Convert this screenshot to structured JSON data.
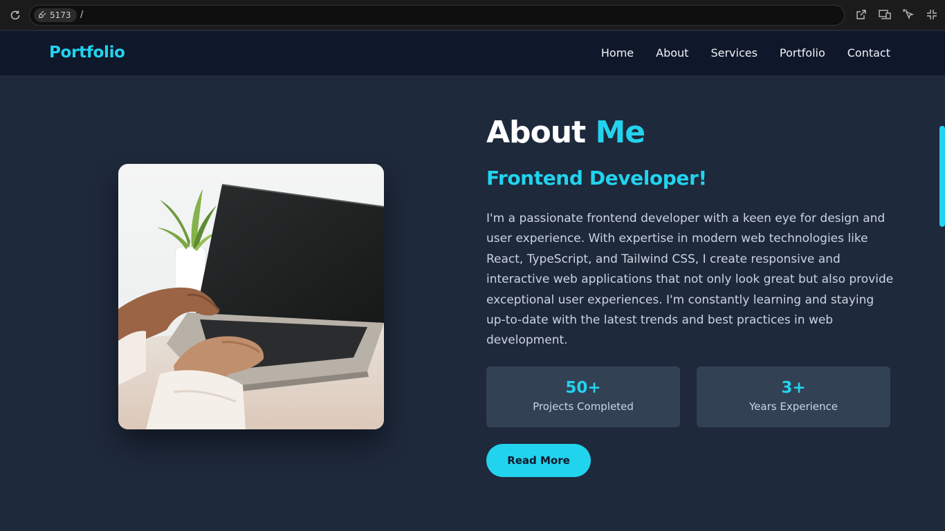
{
  "browser": {
    "port": "5173",
    "path": "/",
    "icons": [
      "reload-icon",
      "plug-icon",
      "open-external-icon",
      "device-toggle-icon",
      "element-picker-icon",
      "collapse-icon"
    ]
  },
  "nav": {
    "logo": "Portfolio",
    "links": [
      "Home",
      "About",
      "Services",
      "Portfolio",
      "Contact"
    ]
  },
  "about": {
    "title_part1": "About ",
    "title_part2": "Me",
    "subtitle": "Frontend Developer!",
    "bio": "I'm a passionate frontend developer with a keen eye for design and user experience. With expertise in modern web technologies like React, TypeScript, and Tailwind CSS, I create responsive and interactive web applications that not only look great but also provide exceptional user experiences. I'm constantly learning and staying up-to-date with the latest trends and best practices in web development.",
    "stats": [
      {
        "value": "50+",
        "label": "Projects Completed"
      },
      {
        "value": "3+",
        "label": "Years Experience"
      }
    ],
    "button": "Read More",
    "image": "laptop-typing-photo"
  },
  "colors": {
    "accent": "#22d3ee",
    "background": "#1e293b",
    "nav_bg": "#0f172a",
    "card_bg": "#334155"
  }
}
